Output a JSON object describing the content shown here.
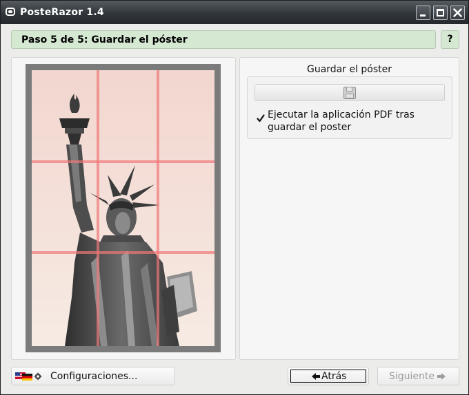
{
  "window": {
    "title": "PosteRazor 1.4"
  },
  "wizard": {
    "step_title": "Paso 5 de 5: Guardar el póster",
    "help_label": "?"
  },
  "save_section": {
    "title": "Guardar el póster",
    "save_icon": "floppy-disk-icon",
    "launch_pdf_checked": true,
    "launch_pdf_label": "Ejecutar la aplicación PDF tras guardar el poster"
  },
  "buttons": {
    "settings_label": "Configuraciones...",
    "back_label": "Atrás",
    "next_label": "Siguiente",
    "next_enabled": false
  },
  "preview": {
    "grid_columns": 3,
    "grid_rows": 3
  },
  "colors": {
    "step_bar_bg": "#d4e8d2",
    "grid_line": "#f07878",
    "titlebar": "#30353a"
  }
}
